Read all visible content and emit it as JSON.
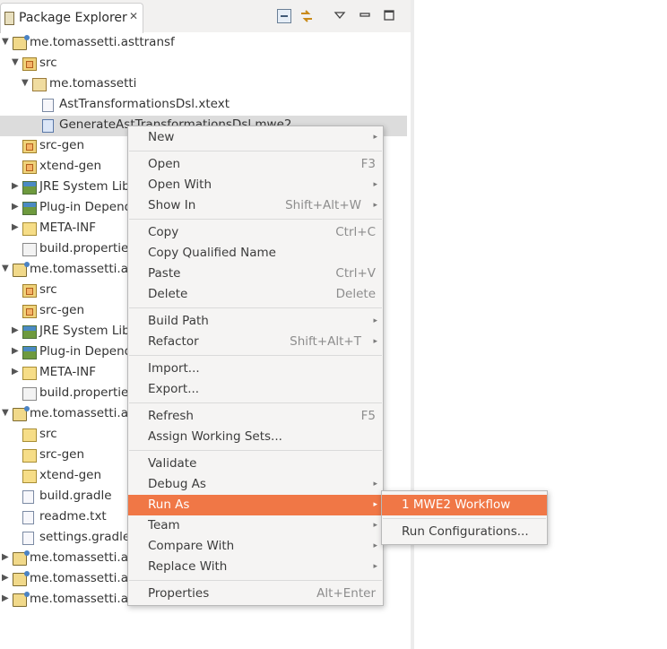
{
  "view": {
    "title": "Package Explorer",
    "close_glyph": "✕",
    "toolbar": {
      "collapse_icon": "collapse-all-icon",
      "link_icon": "link-with-editor-icon",
      "menu_glyph": "▽",
      "minimize_glyph": "▬",
      "maximize_glyph": "▢"
    }
  },
  "tree": [
    {
      "label": "me.tomassetti.asttransf",
      "icon": "project",
      "twisty": "▼"
    },
    {
      "label": "src",
      "icon": "src-folder",
      "twisty": "▼"
    },
    {
      "label": "me.tomassetti",
      "icon": "package",
      "twisty": "▼"
    },
    {
      "label": "AstTransformationsDsl.xtext",
      "icon": "file",
      "twisty": ""
    },
    {
      "label": "GenerateAstTransformationsDsl.mwe2",
      "icon": "file-blue",
      "twisty": ""
    },
    {
      "label": "src-gen",
      "icon": "src-folder",
      "twisty": ""
    },
    {
      "label": "xtend-gen",
      "icon": "src-folder",
      "twisty": ""
    },
    {
      "label": "JRE System Library",
      "icon": "library",
      "twisty": "▶"
    },
    {
      "label": "Plug-in Dependencies",
      "icon": "library",
      "twisty": "▶"
    },
    {
      "label": "META-INF",
      "icon": "folder",
      "twisty": "▶"
    },
    {
      "label": "build.properties",
      "icon": "properties-file",
      "twisty": ""
    },
    {
      "label": "me.tomassetti.a",
      "icon": "project",
      "twisty": "▼"
    },
    {
      "label": "src",
      "icon": "src-folder",
      "twisty": ""
    },
    {
      "label": "src-gen",
      "icon": "src-folder",
      "twisty": ""
    },
    {
      "label": "JRE System Library",
      "icon": "library",
      "twisty": "▶"
    },
    {
      "label": "Plug-in Dependencies",
      "icon": "library",
      "twisty": "▶"
    },
    {
      "label": "META-INF",
      "icon": "folder",
      "twisty": "▶"
    },
    {
      "label": "build.properties",
      "icon": "properties-file",
      "twisty": ""
    },
    {
      "label": "me.tomassetti.a",
      "icon": "project",
      "twisty": "▼"
    },
    {
      "label": "src",
      "icon": "folder",
      "twisty": ""
    },
    {
      "label": "src-gen",
      "icon": "folder",
      "twisty": ""
    },
    {
      "label": "xtend-gen",
      "icon": "folder",
      "twisty": ""
    },
    {
      "label": "build.gradle",
      "icon": "file",
      "twisty": ""
    },
    {
      "label": "readme.txt",
      "icon": "file",
      "twisty": ""
    },
    {
      "label": "settings.gradle",
      "icon": "file",
      "twisty": ""
    },
    {
      "label": "me.tomassetti.a",
      "icon": "project",
      "twisty": "▶"
    },
    {
      "label": "me.tomassetti.a",
      "icon": "project",
      "twisty": "▶"
    },
    {
      "label": "me.tomassetti.a",
      "icon": "project",
      "twisty": "▶"
    }
  ],
  "context_menu": {
    "items": [
      {
        "label": "New",
        "accel": "",
        "submenu": true
      },
      {
        "sep": true
      },
      {
        "label": "Open",
        "accel": "F3",
        "submenu": false
      },
      {
        "label": "Open With",
        "accel": "",
        "submenu": true
      },
      {
        "label": "Show In",
        "accel": "Shift+Alt+W",
        "submenu": true
      },
      {
        "sep": true
      },
      {
        "label": "Copy",
        "accel": "Ctrl+C",
        "submenu": false
      },
      {
        "label": "Copy Qualified Name",
        "accel": "",
        "submenu": false
      },
      {
        "label": "Paste",
        "accel": "Ctrl+V",
        "submenu": false
      },
      {
        "label": "Delete",
        "accel": "Delete",
        "submenu": false
      },
      {
        "sep": true
      },
      {
        "label": "Build Path",
        "accel": "",
        "submenu": true
      },
      {
        "label": "Refactor",
        "accel": "Shift+Alt+T",
        "submenu": true
      },
      {
        "sep": true
      },
      {
        "label": "Import...",
        "accel": "",
        "submenu": false
      },
      {
        "label": "Export...",
        "accel": "",
        "submenu": false
      },
      {
        "sep": true
      },
      {
        "label": "Refresh",
        "accel": "F5",
        "submenu": false
      },
      {
        "label": "Assign Working Sets...",
        "accel": "",
        "submenu": false
      },
      {
        "sep": true
      },
      {
        "label": "Validate",
        "accel": "",
        "submenu": false
      },
      {
        "label": "Debug As",
        "accel": "",
        "submenu": true
      },
      {
        "label": "Run As",
        "accel": "",
        "submenu": true,
        "highlighted": true
      },
      {
        "label": "Team",
        "accel": "",
        "submenu": true
      },
      {
        "label": "Compare With",
        "accel": "",
        "submenu": true
      },
      {
        "label": "Replace With",
        "accel": "",
        "submenu": true
      },
      {
        "sep": true
      },
      {
        "label": "Properties",
        "accel": "Alt+Enter",
        "submenu": false
      }
    ],
    "submenu_glyph": "▸"
  },
  "run_as_submenu": {
    "items": [
      {
        "label": "1 MWE2 Workflow",
        "highlighted": true
      },
      {
        "sep": true
      },
      {
        "label": "Run Configurations...",
        "highlighted": false
      }
    ]
  },
  "colors": {
    "highlight": "#f07746",
    "selection_row": "#dcdcdc",
    "menu_bg": "#f5f4f3"
  }
}
